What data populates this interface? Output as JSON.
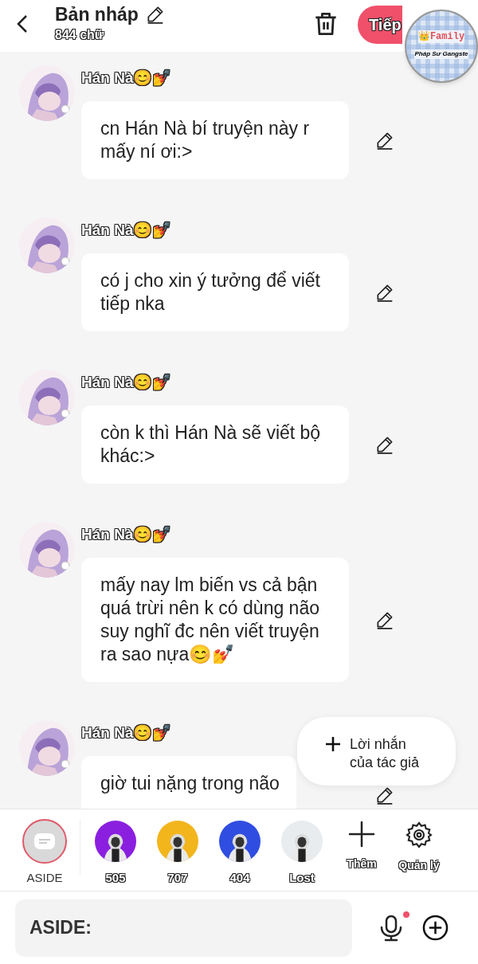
{
  "header": {
    "title": "Bản nháp",
    "word_count": "844 chữ",
    "next_button": "Tiếp"
  },
  "sticker": {
    "top": "👑Family",
    "bottom": "Pháp Sư Gangste"
  },
  "messages": [
    {
      "author": "Hán Nà😊💅",
      "text": "cn Hán Nà bí truyện này r mấy ní ơi:>"
    },
    {
      "author": "Hán Nà😊💅",
      "text": "có j cho xin ý tưởng để viết tiếp nka"
    },
    {
      "author": "Hán Nà😊💅",
      "text": "còn k thì Hán Nà sẽ viết bộ khác:>"
    },
    {
      "author": "Hán Nà😊💅",
      "text": "mấy nay lm biến vs cả bận quá trừi nên k có dùng não suy nghĩ đc nên viết truyện ra sao nựa😊💅"
    },
    {
      "author": "Hán Nà😊💅",
      "text": "giờ tui nặng trong não"
    }
  ],
  "author_note_button": "Lời nhắn của tác giả",
  "characters": [
    {
      "name": "ASIDE",
      "kind": "aside",
      "selected": true
    },
    {
      "name": "505",
      "kind": "avatar",
      "selected": false,
      "color": "#8b1fe0"
    },
    {
      "name": "707",
      "kind": "avatar",
      "selected": false,
      "color": "#f2b51c"
    },
    {
      "name": "404",
      "kind": "avatar",
      "selected": false,
      "color": "#2f4de0"
    },
    {
      "name": "Lost",
      "kind": "avatar",
      "selected": false,
      "color": "#e8ecef"
    }
  ],
  "actions": [
    {
      "label": "Thêm",
      "kind": "add"
    },
    {
      "label": "Quản lý",
      "kind": "manage"
    }
  ],
  "input": {
    "placeholder": "ASIDE:"
  }
}
